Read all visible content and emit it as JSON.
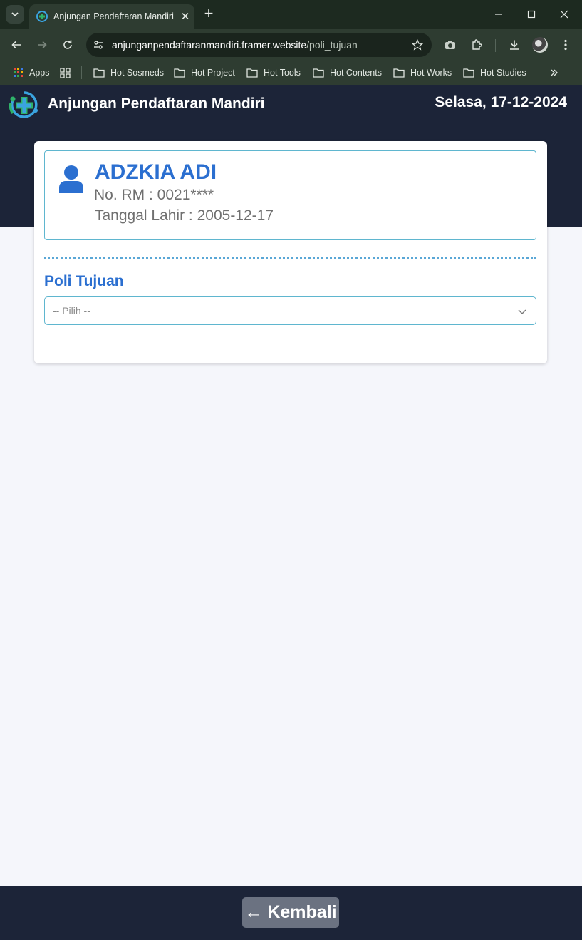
{
  "browser": {
    "tab_title": "Anjungan Pendaftaran Mandiri",
    "url_domain": "anjunganpendaftaranmandiri.framer.website",
    "url_path": "/poli_tujuan",
    "bookmarks": [
      "Apps",
      "Hot Sosmeds",
      "Hot Project",
      "Hot Tools",
      "Hot Contents",
      "Hot Works",
      "Hot Studies"
    ]
  },
  "header": {
    "title": "Anjungan Pendaftaran Mandiri",
    "date": "Selasa, 17-12-2024"
  },
  "patient": {
    "name": "ADZKIA ADI",
    "rm": "No. RM : 0021****",
    "dob": "Tanggal Lahir : 2005-12-17"
  },
  "form": {
    "poli_label": "Poli Tujuan",
    "select_placeholder": "-- Pilih --"
  },
  "footer": {
    "back_label": "← Kembali"
  },
  "colors": {
    "header_bg": "#1c2438",
    "accent": "#2b6fd0",
    "border": "#5fb6cf",
    "page_bg": "#f5f6fb"
  }
}
